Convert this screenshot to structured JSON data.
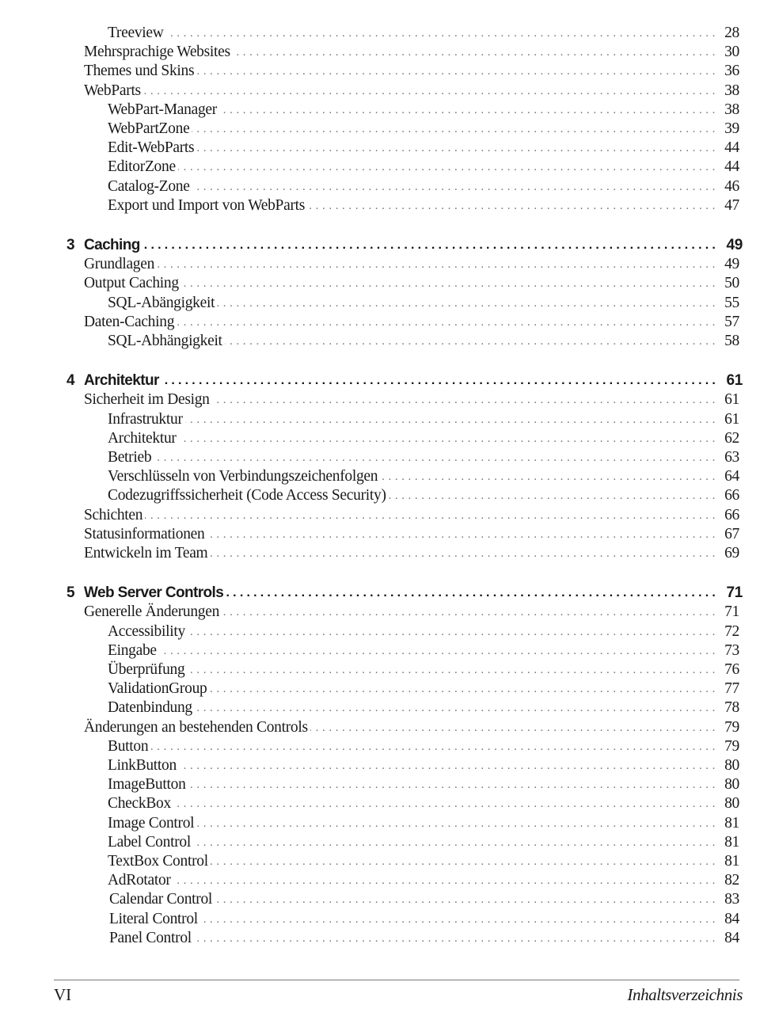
{
  "toc": {
    "entries": [
      {
        "level": "l2",
        "title": "Treeview",
        "page": "28"
      },
      {
        "level": "l1",
        "title": "Mehrsprachige Websites",
        "page": "30"
      },
      {
        "level": "l1",
        "title": "Themes und Skins",
        "page": "36"
      },
      {
        "level": "l1",
        "title": "WebParts",
        "page": "38"
      },
      {
        "level": "l2",
        "title": "WebPart-Manager",
        "page": "38"
      },
      {
        "level": "l2",
        "title": "WebPartZone",
        "page": "39"
      },
      {
        "level": "l2",
        "title": "Edit-WebParts",
        "page": "44"
      },
      {
        "level": "l2",
        "title": "EditorZone",
        "page": "44"
      },
      {
        "level": "l2",
        "title": "Catalog-Zone",
        "page": "46"
      },
      {
        "level": "l2",
        "title": "Export und Import von WebParts",
        "page": "47"
      },
      {
        "level": "chapter",
        "number": "3",
        "title": "Caching",
        "page": "49"
      },
      {
        "level": "l1",
        "title": "Grundlagen",
        "page": "49"
      },
      {
        "level": "l1",
        "title": "Output Caching",
        "page": "50"
      },
      {
        "level": "l2",
        "title": "SQL-Abängigkeit",
        "page": "55"
      },
      {
        "level": "l1",
        "title": "Daten-Caching",
        "page": "57"
      },
      {
        "level": "l2",
        "title": "SQL-Abhängigkeit",
        "page": "58"
      },
      {
        "level": "chapter",
        "number": "4",
        "title": "Architektur",
        "page": "61"
      },
      {
        "level": "l1",
        "title": "Sicherheit im Design",
        "page": "61"
      },
      {
        "level": "l2",
        "title": "Infrastruktur",
        "page": "61"
      },
      {
        "level": "l2",
        "title": "Architektur",
        "page": "62"
      },
      {
        "level": "l2",
        "title": "Betrieb",
        "page": "63"
      },
      {
        "level": "l2",
        "title": "Verschlüsseln von Verbindungszeichenfolgen",
        "page": "64"
      },
      {
        "level": "l2",
        "title": "Codezugriffssicherheit (Code Access Security)",
        "page": "66"
      },
      {
        "level": "l1",
        "title": "Schichten",
        "page": "66"
      },
      {
        "level": "l1",
        "title": "Statusinformationen",
        "page": "67"
      },
      {
        "level": "l1",
        "title": "Entwickeln im Team",
        "page": "69"
      },
      {
        "level": "chapter",
        "number": "5",
        "title": "Web Server Controls",
        "page": "71"
      },
      {
        "level": "l1",
        "title": "Generelle Änderungen",
        "page": "71"
      },
      {
        "level": "l2",
        "title": "Accessibility",
        "page": "72"
      },
      {
        "level": "l2",
        "title": "Eingabe",
        "page": "73"
      },
      {
        "level": "l2",
        "title": "Überprüfung",
        "page": "76"
      },
      {
        "level": "l2",
        "title": "ValidationGroup",
        "page": "77"
      },
      {
        "level": "l2",
        "title": "Datenbindung",
        "page": "78"
      },
      {
        "level": "l1",
        "title": "Änderungen an bestehenden Controls",
        "page": "79"
      },
      {
        "level": "l2",
        "title": "Button",
        "page": "79"
      },
      {
        "level": "l2",
        "title": "LinkButton",
        "page": "80"
      },
      {
        "level": "l2",
        "title": "ImageButton",
        "page": "80"
      },
      {
        "level": "l2",
        "title": "CheckBox",
        "page": "80"
      },
      {
        "level": "l2",
        "title": "Image Control",
        "page": "81"
      },
      {
        "level": "l2",
        "title": "Label Control",
        "page": "81"
      },
      {
        "level": "l2",
        "title": "TextBox Control",
        "page": "81"
      },
      {
        "level": "l2",
        "title": "AdRotator",
        "page": "82"
      },
      {
        "level": "l2b",
        "title": "Calendar Control",
        "page": "83"
      },
      {
        "level": "l2b",
        "title": "Literal Control",
        "page": "84"
      },
      {
        "level": "l2b",
        "title": "Panel Control",
        "page": "84"
      }
    ]
  },
  "footer": {
    "page_number": "VI",
    "section_title": "Inhaltsverzeichnis"
  }
}
